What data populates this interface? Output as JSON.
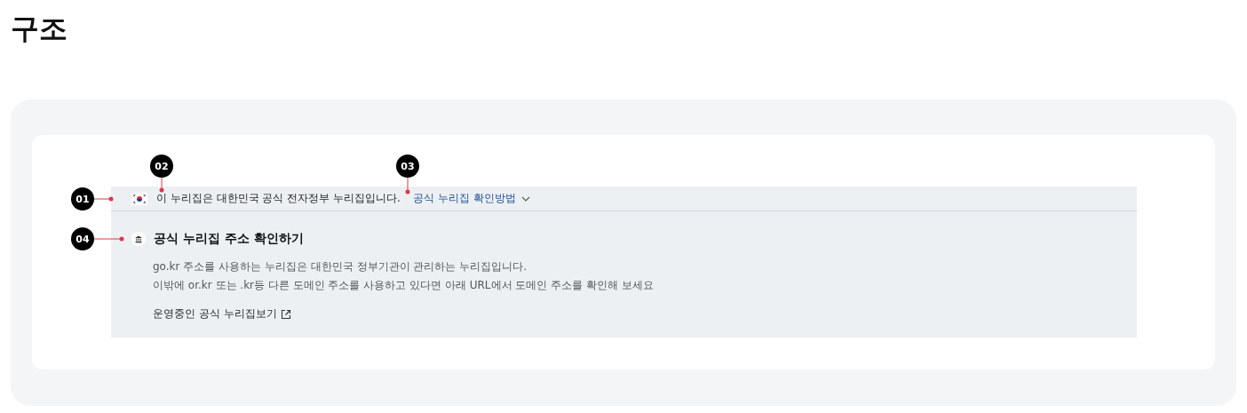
{
  "page_title": "구조",
  "banner": {
    "notice": "이 누리집은 대한민국 공식 전자정부 누리집입니다.",
    "toggle_link": "공식 누리집 확인방법",
    "expanded": true,
    "heading": "공식 누리집 주소 확인하기",
    "description": [
      "go.kr 주소를 사용하는 누리집은 대한민국 정부기관이 관리하는 누리집입니다.",
      "이밖에 or.kr 또는 .kr등 다른 도메인 주소를 사용하고 있다면 아래 URL에서 도메인 주소를 확인해 보세요"
    ],
    "external_link": "운영중인 공식 누리집보기"
  },
  "callouts": [
    {
      "label": "01"
    },
    {
      "label": "02"
    },
    {
      "label": "03"
    },
    {
      "label": "04"
    }
  ]
}
